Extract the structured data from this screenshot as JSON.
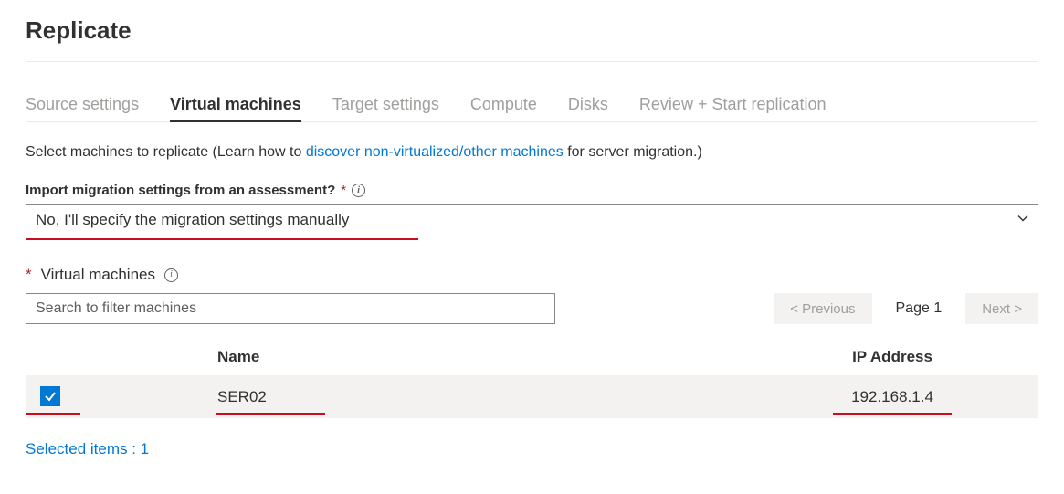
{
  "title": "Replicate",
  "tabs": [
    {
      "label": "Source settings",
      "active": false
    },
    {
      "label": "Virtual machines",
      "active": true
    },
    {
      "label": "Target settings",
      "active": false
    },
    {
      "label": "Compute",
      "active": false
    },
    {
      "label": "Disks",
      "active": false
    },
    {
      "label": "Review + Start replication",
      "active": false
    }
  ],
  "instruction": {
    "prefix": "Select machines to replicate (Learn how to ",
    "link_text": "discover non-virtualized/other machines",
    "suffix": " for server migration.)"
  },
  "import_label": "Import migration settings from an assessment?",
  "import_value": "No, I'll specify the migration settings manually",
  "vm_section_label": "Virtual machines",
  "search_placeholder": "Search to filter machines",
  "pager": {
    "prev": "< Previous",
    "page_label": "Page 1",
    "next": "Next >"
  },
  "columns": {
    "name": "Name",
    "ip": "IP Address"
  },
  "rows": [
    {
      "checked": true,
      "name": "SER02",
      "ip": "192.168.1.4"
    }
  ],
  "selected_text": "Selected items : 1"
}
